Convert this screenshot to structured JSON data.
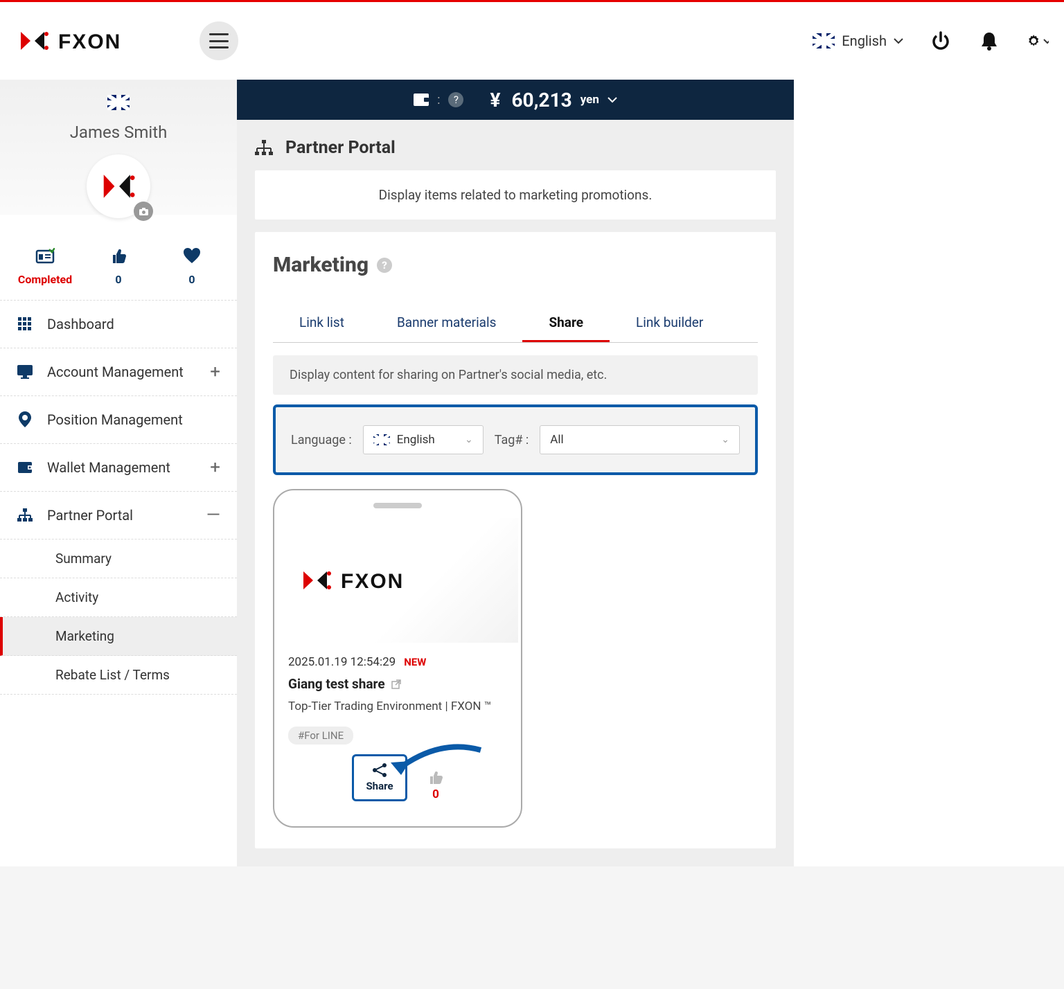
{
  "topbar": {
    "language": "English"
  },
  "balance": {
    "symbol": "¥",
    "amount": "60,213",
    "currency": "yen"
  },
  "sidebar": {
    "user_name": "James Smith",
    "stats": {
      "completed": "Completed",
      "likes": "0",
      "favs": "0"
    },
    "items": {
      "dashboard": "Dashboard",
      "account": "Account Management",
      "position": "Position Management",
      "wallet": "Wallet Management",
      "partner": "Partner Portal"
    },
    "partner_sub": {
      "summary": "Summary",
      "activity": "Activity",
      "marketing": "Marketing",
      "rebate": "Rebate List / Terms"
    }
  },
  "page": {
    "title": "Partner Portal",
    "description": "Display items related to marketing promotions.",
    "section_title": "Marketing"
  },
  "tabs": {
    "link_list": "Link list",
    "banner": "Banner materials",
    "share": "Share",
    "builder": "Link builder"
  },
  "tab_desc": "Display content for sharing on Partner's social media, etc.",
  "filters": {
    "lang_label": "Language :",
    "lang_value": "English",
    "tag_label": "Tag# :",
    "tag_value": "All"
  },
  "post": {
    "date": "2025.01.19 12:54:29",
    "new": "NEW",
    "title": "Giang test share",
    "subtitle": "Top-Tier Trading Environment | FXON ™",
    "tag": "#For LINE",
    "share_label": "Share",
    "like_count": "0"
  }
}
